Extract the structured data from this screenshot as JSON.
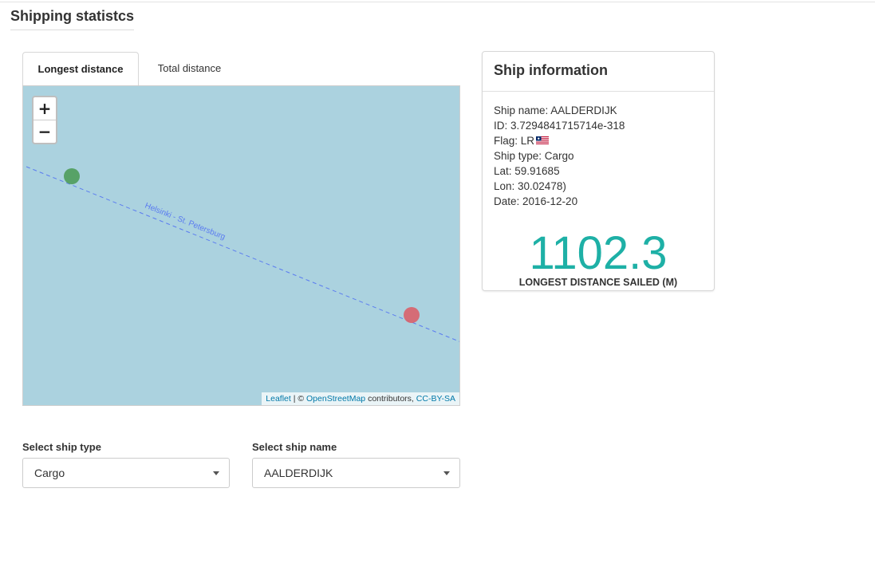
{
  "page": {
    "title": "Shipping statistcs"
  },
  "tabs": [
    {
      "label": "Longest distance",
      "active": true
    },
    {
      "label": "Total distance",
      "active": false
    }
  ],
  "map": {
    "zoom_in": "+",
    "zoom_out": "−",
    "route_label": "Helsinki - St. Petersburg",
    "start_marker_color": "#4e9c5a",
    "end_marker_color": "#d9606a",
    "route_color": "#5b7cf0",
    "water_color": "#abd2df",
    "attribution": {
      "leaflet": "Leaflet",
      "sep1": " | © ",
      "osm": "OpenStreetMap",
      "contrib": " contributors, ",
      "license": "CC-BY-SA"
    }
  },
  "filters": {
    "ship_type": {
      "label": "Select ship type",
      "value": "Cargo"
    },
    "ship_name": {
      "label": "Select ship name",
      "value": "AALDERDIJK"
    }
  },
  "ship_info": {
    "title": "Ship information",
    "name_line": "Ship name: AALDERDIJK",
    "id_line": "ID: 3.7294841715714e-318",
    "flag_line": "Flag: LR",
    "type_line": "Ship type: Cargo",
    "lat_line": "Lat: 59.91685",
    "lon_line": "Lon: 30.02478)",
    "date_line": "Date: 2016-12-20",
    "distance_value": "1102.3",
    "distance_caption": "LONGEST DISTANCE SAILED (M)",
    "accent_color": "#1eb0a6"
  }
}
